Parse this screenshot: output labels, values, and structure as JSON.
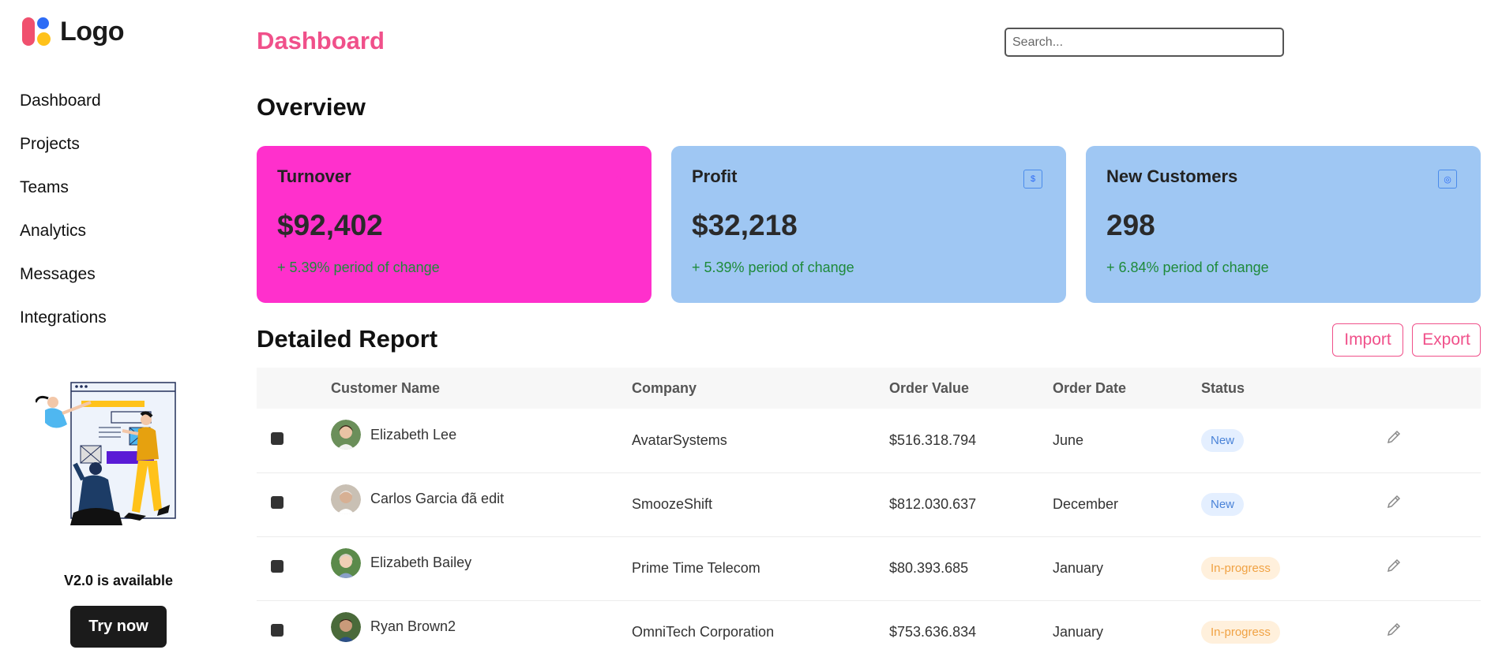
{
  "brand": {
    "name": "Logo"
  },
  "nav": {
    "items": [
      {
        "label": "Dashboard"
      },
      {
        "label": "Projects"
      },
      {
        "label": "Teams"
      },
      {
        "label": "Analytics"
      },
      {
        "label": "Messages"
      },
      {
        "label": "Integrations"
      }
    ]
  },
  "promo": {
    "title": "V2.0 is available",
    "button_label": "Try now"
  },
  "header": {
    "title": "Dashboard",
    "search_placeholder": "Search..."
  },
  "overview": {
    "title": "Overview",
    "cards": [
      {
        "title": "Turnover",
        "value": "$92,402",
        "change": "+ 5.39% period of change",
        "icon": "dollar-icon"
      },
      {
        "title": "Profit",
        "value": "$32,218",
        "change": "+ 5.39% period of change",
        "icon": "dollar-icon"
      },
      {
        "title": "New Customers",
        "value": "298",
        "change": "+ 6.84% period of change",
        "icon": "users-icon"
      }
    ]
  },
  "report": {
    "title": "Detailed Report",
    "import_label": "Import",
    "export_label": "Export",
    "columns": [
      "Customer Name",
      "Company",
      "Order Value",
      "Order Date",
      "Status"
    ],
    "rows": [
      {
        "name": "Elizabeth Lee",
        "company": "AvatarSystems",
        "value": "$516.318.794",
        "date": "June",
        "status": "New"
      },
      {
        "name": "Carlos Garcia đã edit",
        "company": "SmoozeShift",
        "value": "$812.030.637",
        "date": "December",
        "status": "New"
      },
      {
        "name": "Elizabeth Bailey",
        "company": "Prime Time Telecom",
        "value": "$80.393.685",
        "date": "January",
        "status": "In-progress"
      },
      {
        "name": "Ryan Brown2",
        "company": "OmniTech Corporation",
        "value": "$753.636.834",
        "date": "January",
        "status": "In-progress"
      }
    ]
  },
  "colors": {
    "accent": "#f0508a",
    "turnover_card": "#ff30cc",
    "blue_card": "#9fc7f3",
    "positive": "#1e8a3a"
  }
}
